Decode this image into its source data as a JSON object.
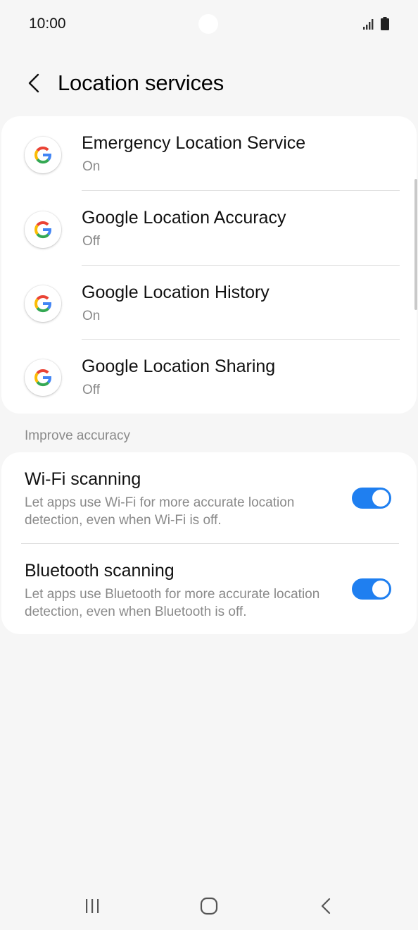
{
  "status_bar": {
    "time": "10:00",
    "icons": [
      "signal-icon",
      "battery-icon"
    ]
  },
  "header": {
    "title": "Location services",
    "back_icon": "chevron-left-icon"
  },
  "services": [
    {
      "title": "Emergency Location Service",
      "status": "On",
      "icon": "google-icon"
    },
    {
      "title": "Google Location Accuracy",
      "status": "Off",
      "icon": "google-icon"
    },
    {
      "title": "Google Location History",
      "status": "On",
      "icon": "google-icon"
    },
    {
      "title": "Google Location Sharing",
      "status": "Off",
      "icon": "google-icon"
    }
  ],
  "improve_accuracy": {
    "label": "Improve accuracy",
    "items": [
      {
        "title": "Wi-Fi scanning",
        "description": "Let apps use Wi-Fi for more accurate location detection, even when Wi-Fi is off.",
        "enabled": true
      },
      {
        "title": "Bluetooth scanning",
        "description": "Let apps use Bluetooth for more accurate location detection, even when Bluetooth is off.",
        "enabled": true
      }
    ]
  },
  "nav_bar": {
    "icons": [
      "recents-icon",
      "home-icon",
      "back-icon"
    ]
  },
  "colors": {
    "accent": "#1f7ff0",
    "background": "#f6f6f6",
    "card": "#ffffff",
    "secondary_text": "#8a8a8a"
  }
}
